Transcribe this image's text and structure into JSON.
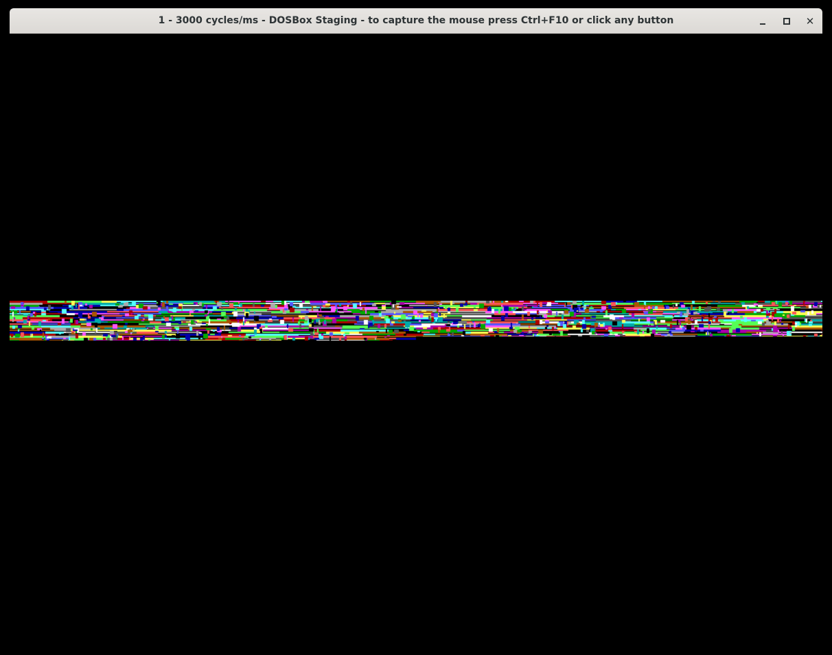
{
  "window": {
    "title": "1 - 3000 cycles/ms - DOSBox Staging - to capture the mouse press Ctrl+F10 or click any button",
    "controls": {
      "minimize_icon": "minimize-icon",
      "maximize_icon": "maximize-icon",
      "close_icon": "close-icon",
      "close_glyph": "✕"
    }
  },
  "screen": {
    "background": "#000000",
    "content": "garbled-text-mode-display",
    "palette": [
      "#000000",
      "#0000aa",
      "#00aa00",
      "#00aaaa",
      "#aa0000",
      "#aa00aa",
      "#aa5500",
      "#aaaaaa",
      "#555555",
      "#5555ff",
      "#55ff55",
      "#55ffff",
      "#ff5555",
      "#ff55ff",
      "#ffff55",
      "#ffffff"
    ]
  }
}
